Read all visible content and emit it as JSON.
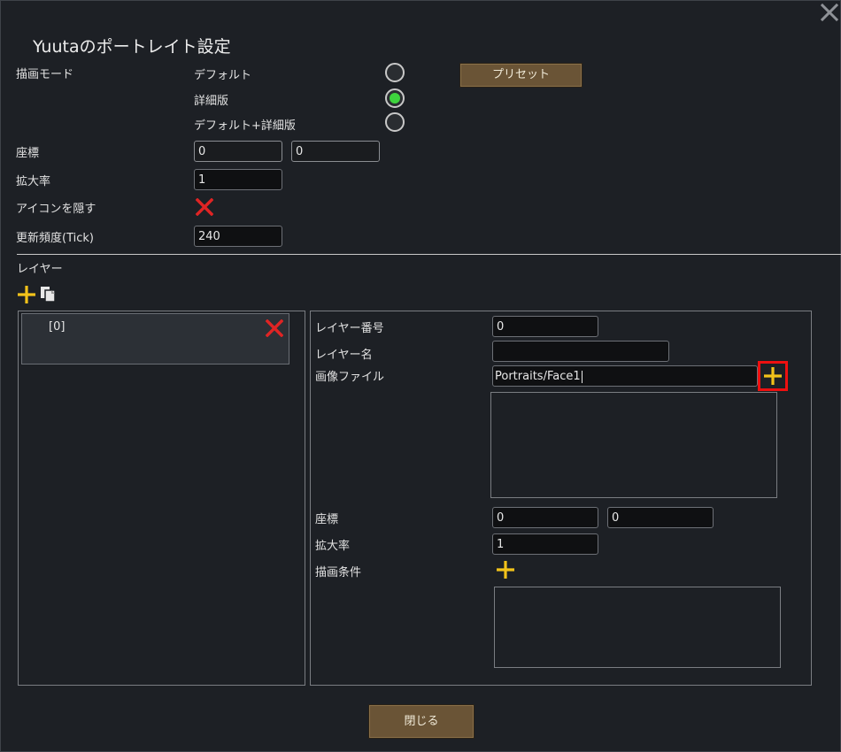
{
  "window": {
    "title": "Yuutaのポートレイト設定",
    "close_icon": "close-icon"
  },
  "draw_mode": {
    "label": "描画モード",
    "options": [
      {
        "label": "デフォルト",
        "selected": false
      },
      {
        "label": "詳細版",
        "selected": true
      },
      {
        "label": "デフォルト+詳細版",
        "selected": false
      }
    ],
    "preset_button": "プリセット"
  },
  "coords": {
    "label": "座標",
    "x": "0",
    "y": "0"
  },
  "scale": {
    "label": "拡大率",
    "value": "1"
  },
  "hide_icon": {
    "label": "アイコンを隠す",
    "state_icon": "cross-icon"
  },
  "update_freq": {
    "label": "更新頻度(Tick)",
    "value": "240"
  },
  "layers": {
    "section_label": "レイヤー",
    "add_icon": "plus-icon",
    "copy_icon": "copy-icon",
    "items": [
      {
        "label": "[0]",
        "delete_icon": "cross-icon"
      }
    ]
  },
  "layer_detail": {
    "number_label": "レイヤー番号",
    "number_value": "0",
    "name_label": "レイヤー名",
    "name_value": "",
    "image_label": "画像ファイル",
    "image_value": "Portraits/Face1",
    "add_image_icon": "plus-icon",
    "coords_label": "座標",
    "coord_x": "0",
    "coord_y": "0",
    "scale_label": "拡大率",
    "scale_value": "1",
    "condition_label": "描画条件",
    "add_condition_icon": "plus-icon"
  },
  "footer": {
    "close_button": "閉じる"
  },
  "colors": {
    "background": "#1d2025",
    "button": "#6a5436",
    "radio_selected": "#3ed43e",
    "plus_icon": "#f2c21a",
    "cross_icon": "#e02424",
    "highlight": "#ee1010"
  }
}
